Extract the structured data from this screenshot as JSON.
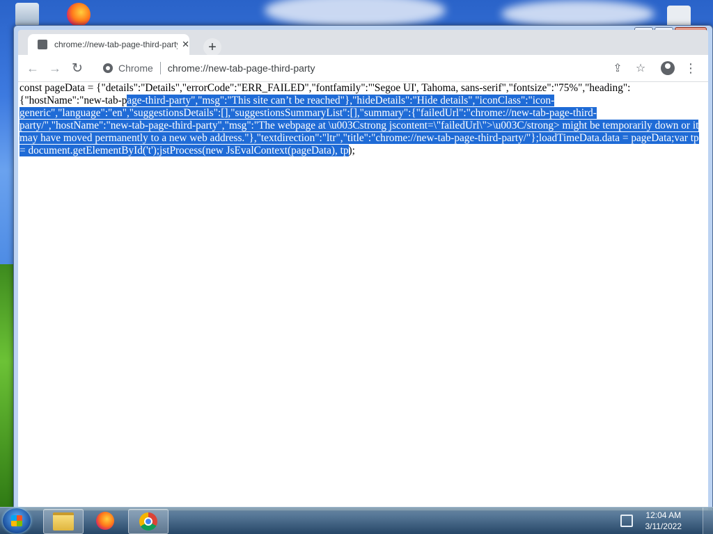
{
  "browser": {
    "tab_title": "chrome://new-tab-page-third-party",
    "chip_label": "Chrome",
    "url": "chrome://new-tab-page-third-party"
  },
  "content": {
    "line_start": "const pageData = {\"details\":\"Details\",\"errorCode\":\"ERR_FAILED\",\"fontfamily\":\"'Segoe UI', Tahoma, sans-serif\",\"fontsize\":\"75%\",\"heading\":{\"hostName\":\"new-tab-p",
    "selected_text": "age-third-party\",\"msg\":\"This site can’t be reached\"},\"hideDetails\":\"Hide details\",\"iconClass\":\"icon-generic\",\"language\":\"en\",\"suggestionsDetails\":[],\"suggestionsSummaryList\":[],\"summary\":{\"failedUrl\":\"chrome://new-tab-page-third-party/\",\"hostName\":\"new-tab-page-third-party\",\"msg\":\"The webpage at \\u003Cstrong jscontent=\\\"failedUrl\\\">\\u003C/strong> might be temporarily down or it may have moved permanently to a new web address.\"},\"textdirection\":\"ltr\",\"title\":\"chrome://new-tab-page-third-party/\"};loadTimeData.data = pageData;var tp = document.getElementById('t');jstProcess(new JsEvalContext(pageData), tp",
    "line_end": ");"
  },
  "taskbar": {
    "time": "12:04 AM",
    "date": "3/11/2022"
  },
  "icons": {
    "back": "arrow-left-icon",
    "forward": "arrow-right-icon",
    "reload": "reload-icon",
    "share": "share-icon",
    "bookmark": "star-icon",
    "profile": "profile-icon",
    "menu": "kebab-menu-icon"
  },
  "colors": {
    "selection": "#1f6bd6",
    "tabstrip": "#dee1e6"
  }
}
